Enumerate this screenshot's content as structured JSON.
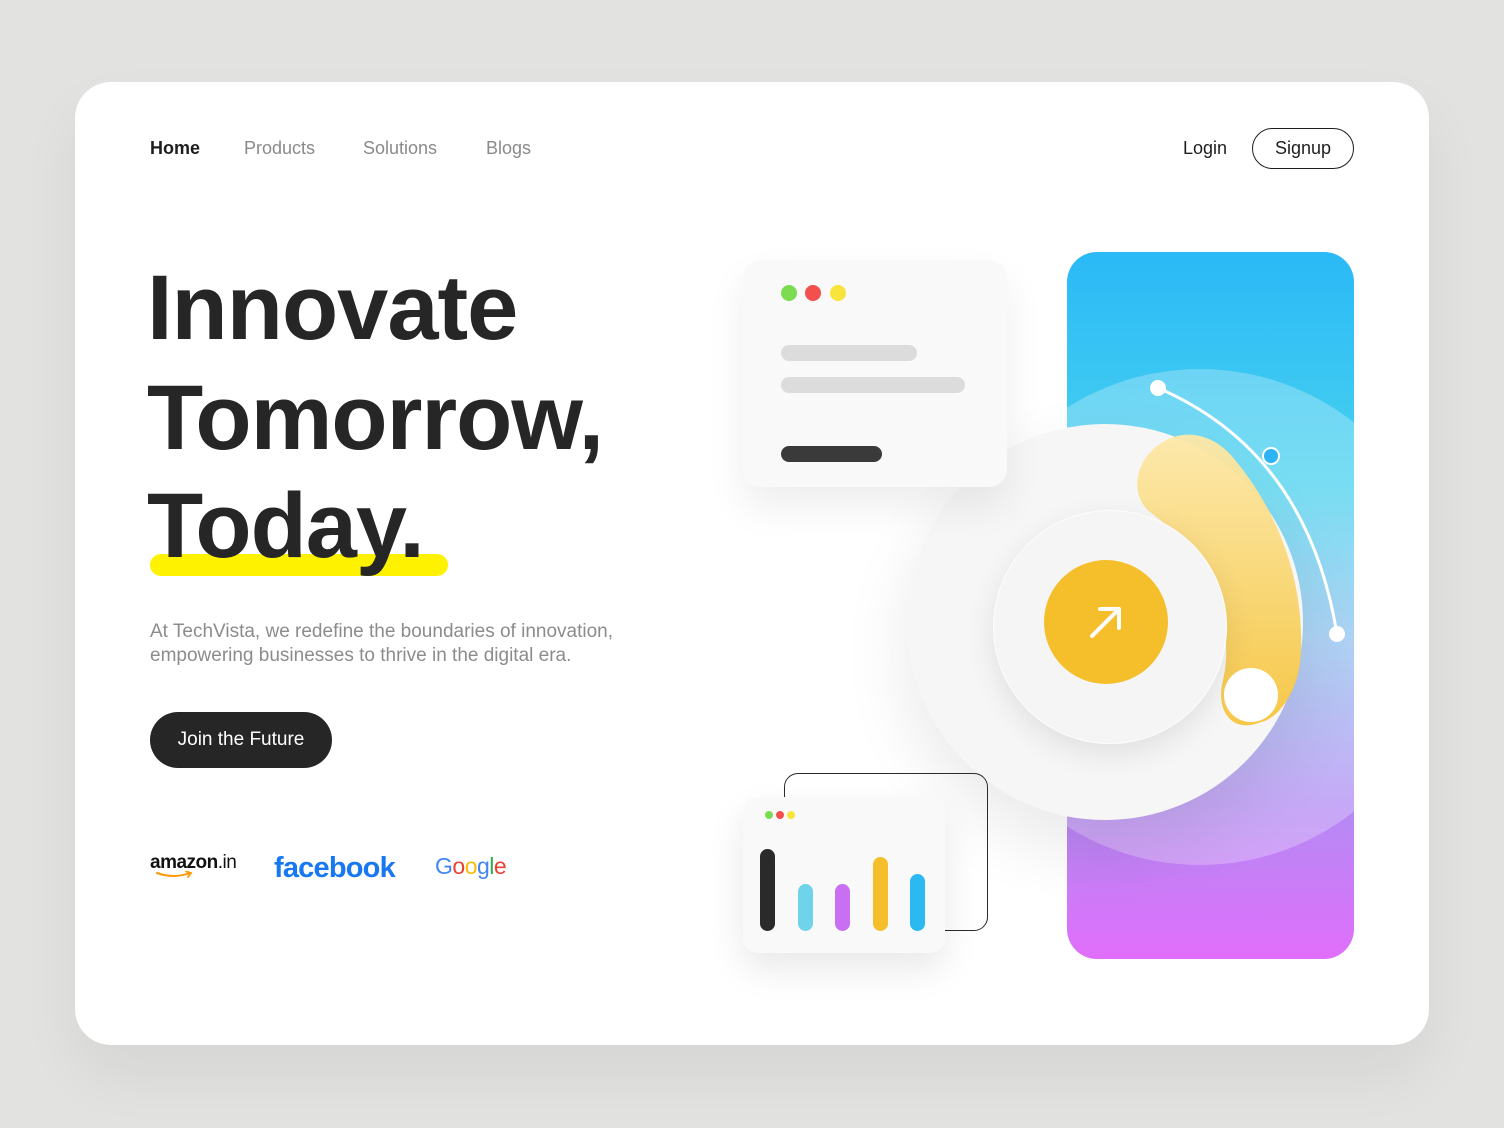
{
  "nav": {
    "links": [
      "Home",
      "Products",
      "Solutions",
      "Blogs"
    ],
    "active": "Home",
    "login_label": "Login",
    "signup_label": "Signup"
  },
  "hero": {
    "line1": "Innovate",
    "line2": "Tomorrow,",
    "line3": "Today.",
    "description": "At TechVista, we redefine the boundaries of innovation, empowering businesses to thrive in the digital era.",
    "cta_label": "Join the Future"
  },
  "partners": {
    "amazon_main": "amazon",
    "amazon_tld": ".in",
    "facebook": "facebook",
    "google": [
      "G",
      "o",
      "o",
      "g",
      "l",
      "e"
    ]
  },
  "colors": {
    "text_dark": "#262626",
    "text_muted": "#8a8a8a",
    "highlight": "#fff200",
    "accent_yellow": "#f5bf2c",
    "panel_top": "#2bb9f7",
    "panel_bottom": "#e16efb",
    "dot_green": "#7bdc52",
    "dot_red": "#f44f4f",
    "dot_yellow": "#f8e43a",
    "facebook_blue": "#1877f2",
    "google": [
      "#4285f4",
      "#ea4335",
      "#fbbc05",
      "#4285f4",
      "#34a853",
      "#ea4335"
    ]
  },
  "icons": {
    "window_dots": [
      "green-dot",
      "red-dot",
      "yellow-dot"
    ],
    "orb": "arrow-up-right-icon"
  },
  "mini_chart": {
    "type": "bar",
    "values": [
      0.82,
      0.47,
      0.47,
      0.74,
      0.57
    ],
    "colors": [
      "#2a2a2a",
      "#6fd3ea",
      "#c86ff2",
      "#f5bf2c",
      "#2cb9f1"
    ]
  }
}
